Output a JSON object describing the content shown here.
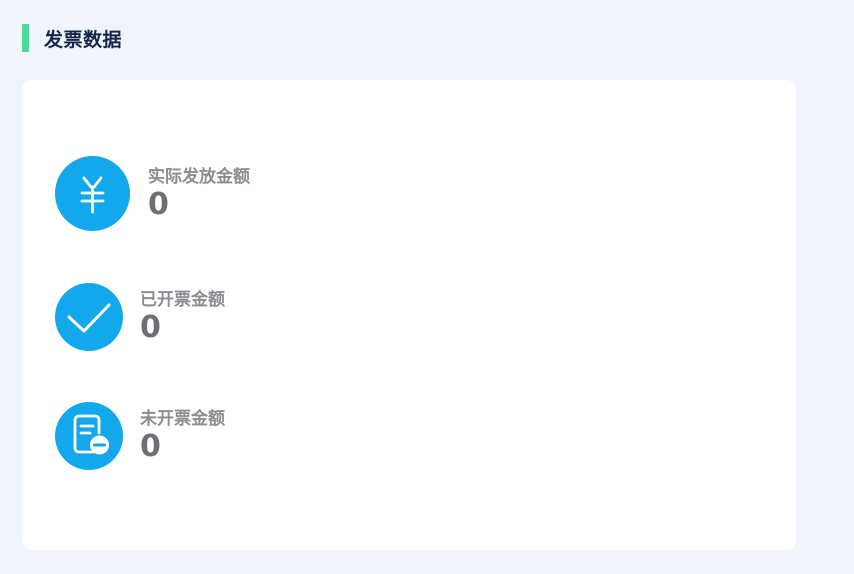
{
  "section": {
    "title": "发票数据"
  },
  "metrics": [
    {
      "label": "实际发放金额",
      "value": "0",
      "icon": "yen-icon"
    },
    {
      "label": "已开票金额",
      "value": "0",
      "icon": "checkmark-icon"
    },
    {
      "label": "未开票金额",
      "value": "0",
      "icon": "document-minus-icon"
    }
  ],
  "colors": {
    "page_background": "#f0f5fd",
    "accent_bar": "#4fd89a",
    "icon_circle": "#13a7eb",
    "title_text": "#16254a",
    "label_text": "#8a8d93",
    "value_text": "#6d6f72"
  }
}
